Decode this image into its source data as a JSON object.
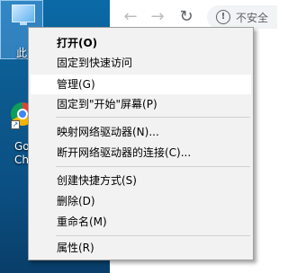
{
  "desktop": {
    "this_pc_label": "此",
    "chrome_shortcut_label": "Go\nCh"
  },
  "browser": {
    "nav": {
      "back_icon": "←",
      "forward_icon": "→",
      "reload_icon": "↻"
    },
    "omnibox": {
      "security_icon": "!",
      "security_text": "不安全"
    }
  },
  "context_menu": {
    "items": [
      {
        "label": "打开(O)"
      },
      {
        "label": "固定到快速访问"
      },
      {
        "label": "管理(G)"
      },
      {
        "label": "固定到\"开始\"屏幕(P)"
      },
      {
        "label": "映射网络驱动器(N)..."
      },
      {
        "label": "断开网络驱动器的连接(C)..."
      },
      {
        "label": "创建快捷方式(S)"
      },
      {
        "label": "删除(D)"
      },
      {
        "label": "重命名(M)"
      },
      {
        "label": "属性(R)"
      }
    ]
  }
}
